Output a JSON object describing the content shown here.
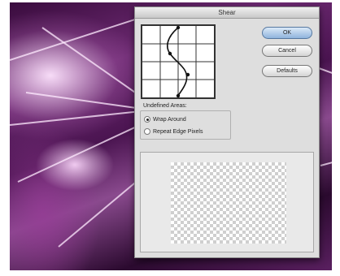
{
  "dialog": {
    "title": "Shear",
    "buttons": {
      "ok": "OK",
      "cancel": "Cancel",
      "defaults": "Defaults"
    }
  },
  "undefined_areas": {
    "label": "Undefined Areas:",
    "options": [
      {
        "label": "Wrap Around",
        "checked": true
      },
      {
        "label": "Repeat Edge Pixels",
        "checked": false
      }
    ]
  },
  "colors": {
    "accent": "#8fb4dc",
    "background_purple": "#6d2a72"
  }
}
